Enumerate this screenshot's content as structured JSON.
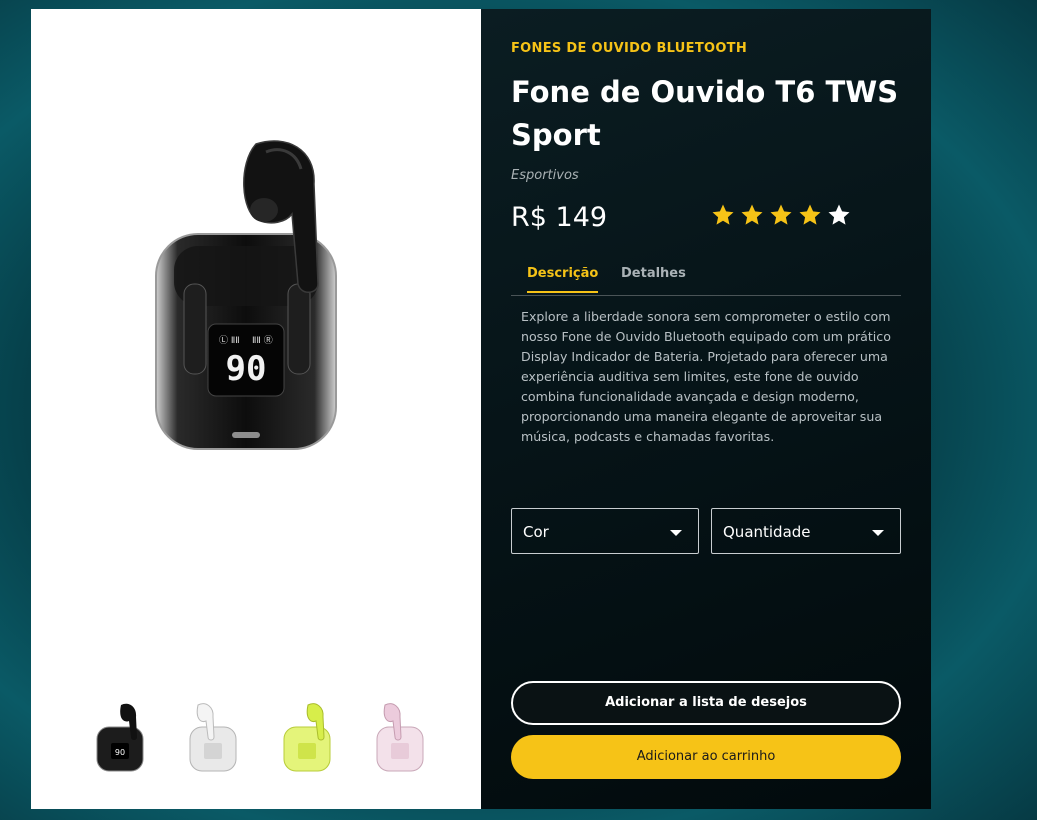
{
  "product": {
    "category": "FONES DE OUVIDO BLUETOOTH",
    "title": "Fone de Ouvido T6 TWS Sport",
    "subcategory": "Esportivos",
    "price": "R$ 149",
    "rating": 5,
    "display_value": "90"
  },
  "tabs": [
    {
      "label": "Descrição",
      "active": true
    },
    {
      "label": "Detalhes",
      "active": false
    }
  ],
  "description": "Explore a liberdade sonora sem comprometer o estilo com nosso Fone de Ouvido Bluetooth equipado com um prático Display Indicador de Bateria. Projetado para oferecer uma experiência auditiva sem limites, este fone de ouvido combina funcionalidade avançada e design moderno, proporcionando uma maneira elegante de aproveitar sua música, podcasts e chamadas favoritas.",
  "selects": {
    "color": "Cor",
    "quantity": "Quantidade"
  },
  "buttons": {
    "wishlist": "Adicionar a lista de desejos",
    "cart": "Adicionar ao carrinho"
  },
  "thumbnails": [
    {
      "name": "black",
      "color": "#1c1c1c"
    },
    {
      "name": "white",
      "color": "#e4e4e4"
    },
    {
      "name": "lime",
      "color": "#d7ee4a"
    },
    {
      "name": "pink",
      "color": "#eccbdc"
    }
  ],
  "colors": {
    "accent": "#f6c317",
    "star_filled": "#f6c317",
    "star_last": "#ffffff"
  }
}
